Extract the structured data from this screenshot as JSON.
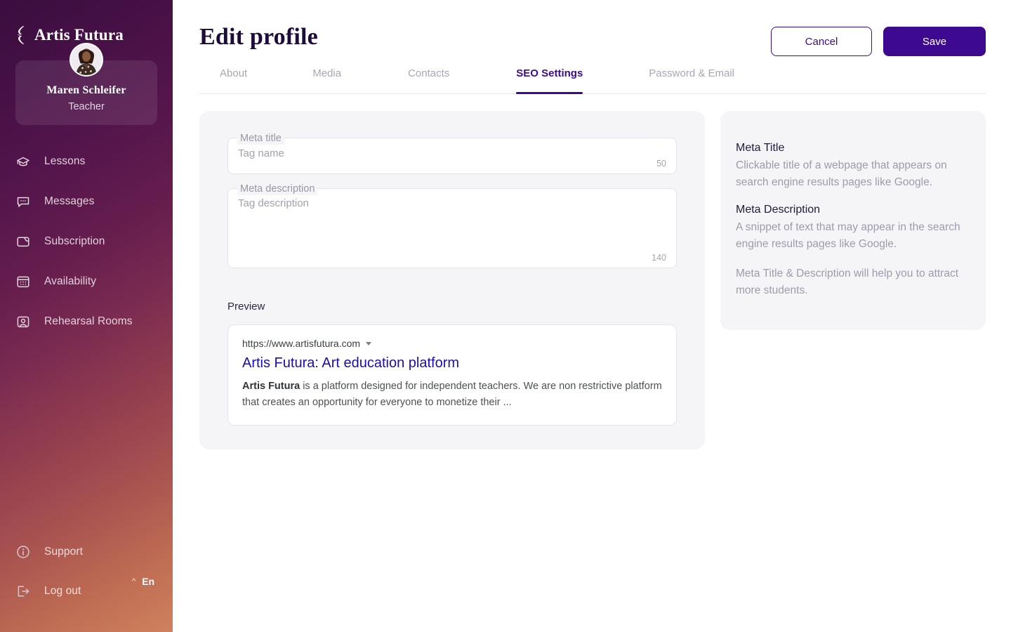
{
  "brand": {
    "name": "Artis Futura",
    "logo_icon": "lightning-bolt-icon"
  },
  "sidebar": {
    "profile": {
      "name": "Maren Schleifer",
      "role": "Teacher",
      "avatar_icon": "user-photo-avatar"
    },
    "items": [
      {
        "label": "Lessons",
        "icon": "graduation-cap-icon"
      },
      {
        "label": "Messages",
        "icon": "chat-bubble-icon"
      },
      {
        "label": "Subscription",
        "icon": "wallet-icon"
      },
      {
        "label": "Availability",
        "icon": "calendar-icon"
      },
      {
        "label": "Rehearsal Rooms",
        "icon": "user-square-icon"
      }
    ],
    "bottom": [
      {
        "label": "Support",
        "icon": "info-circle-icon"
      },
      {
        "label": "Log out",
        "icon": "logout-arrow-icon"
      }
    ],
    "language": {
      "code": "En",
      "caret_icon": "chevron-up-icon"
    },
    "gradient_from": "#3a0d3f",
    "gradient_to": "#cf8260"
  },
  "header": {
    "title": "Edit profile",
    "cancel_label": "Cancel",
    "save_label": "Save",
    "accent_color": "#3d0a8f"
  },
  "tabs": [
    {
      "label": "About",
      "active": false
    },
    {
      "label": "Media",
      "active": false
    },
    {
      "label": "Contacts",
      "active": false
    },
    {
      "label": "SEO Settings",
      "active": true
    },
    {
      "label": "Password & Email",
      "active": false
    }
  ],
  "form": {
    "meta_title": {
      "label": "Meta title",
      "placeholder": "Tag name",
      "value": "",
      "counter": "50"
    },
    "meta_description": {
      "label": "Meta description",
      "placeholder": "Tag description",
      "value": "",
      "counter": "140"
    },
    "preview_label": "Preview",
    "preview": {
      "url": "https://www.artisfutura.com",
      "caret_icon": "chevron-down-icon",
      "title": "Artis Futura: Art education platform",
      "desc_bold": "Artis Futura",
      "desc_rest": " is a platform designed for independent teachers. We are non restrictive platform that creates an opportunity for everyone to monetize their ...",
      "link_color": "#1a0dab"
    }
  },
  "info_panel": {
    "meta_title_heading": "Meta Title",
    "meta_title_text": "Clickable title of a webpage that appears on search engine results pages like Google.",
    "meta_desc_heading": "Meta Description",
    "meta_desc_text": "A snippet of text that may appear in the search engine results  pages like Google.",
    "note": "Meta Title & Description will help you to attract more students."
  }
}
